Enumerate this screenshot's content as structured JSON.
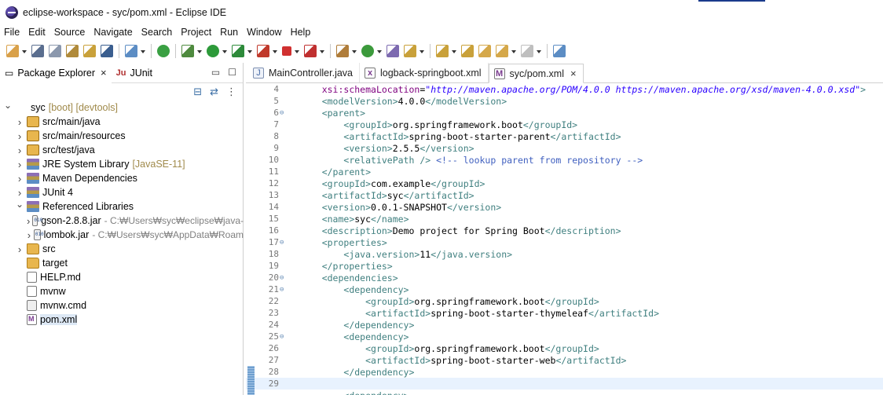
{
  "window": {
    "title": "eclipse-workspace - syc/pom.xml - Eclipse IDE"
  },
  "menu": [
    "File",
    "Edit",
    "Source",
    "Navigate",
    "Search",
    "Project",
    "Run",
    "Window",
    "Help"
  ],
  "left_panel": {
    "tabs": [
      {
        "label": "Package Explorer",
        "icon": "package-explorer-icon",
        "active": true
      },
      {
        "label": "JUnit",
        "icon": "junit-icon",
        "active": false
      }
    ],
    "tree": [
      {
        "label": "syc",
        "decoration": "[boot] [devtools]",
        "icon": "project",
        "level": 0,
        "expanded": true
      },
      {
        "label": "src/main/java",
        "icon": "pkgfolder",
        "level": 1,
        "expanded": false
      },
      {
        "label": "src/main/resources",
        "icon": "pkgfolder",
        "level": 1,
        "expanded": false
      },
      {
        "label": "src/test/java",
        "icon": "pkgfolder",
        "level": 1,
        "expanded": false
      },
      {
        "label": "JRE System Library",
        "decoration": "[JavaSE-11]",
        "icon": "lib",
        "level": 1,
        "expanded": false
      },
      {
        "label": "Maven Dependencies",
        "icon": "lib",
        "level": 1,
        "expanded": false
      },
      {
        "label": "JUnit 4",
        "icon": "lib",
        "level": 1,
        "expanded": false
      },
      {
        "label": "Referenced Libraries",
        "icon": "lib",
        "level": 1,
        "expanded": true
      },
      {
        "label": "gson-2.8.8.jar",
        "path": "- C:₩Users₩syc₩eclipse₩java-",
        "icon": "jar",
        "level": 2,
        "expanded": false
      },
      {
        "label": "lombok.jar",
        "path": "- C:₩Users₩syc₩AppData₩Roam",
        "icon": "jar",
        "level": 2,
        "expanded": false
      },
      {
        "label": "src",
        "icon": "folder",
        "level": 1,
        "expanded": false
      },
      {
        "label": "target",
        "icon": "folder",
        "level": 1,
        "expanded": null
      },
      {
        "label": "HELP.md",
        "icon": "file",
        "level": 1,
        "expanded": null
      },
      {
        "label": "mvnw",
        "icon": "file",
        "level": 1,
        "expanded": null
      },
      {
        "label": "mvnw.cmd",
        "icon": "gear",
        "level": 1,
        "expanded": null
      },
      {
        "label": "pom.xml",
        "icon": "xml",
        "level": 1,
        "expanded": null,
        "selected": true
      }
    ]
  },
  "editor": {
    "tabs": [
      {
        "label": "MainController.java",
        "active": false,
        "icon": "java-file-icon"
      },
      {
        "label": "logback-springboot.xml",
        "active": false,
        "icon": "xml-file-icon"
      },
      {
        "label": "syc/pom.xml",
        "active": true,
        "icon": "maven-pom-icon"
      }
    ],
    "lines": [
      {
        "n": "4",
        "fold": "",
        "text": "    xsi:schemaLocation=\"http://maven.apache.org/POM/4.0.0 https://maven.apache.org/xsd/maven-4.0.0.xsd\">"
      },
      {
        "n": "5",
        "fold": "",
        "text": "    <modelVersion>4.0.0</modelVersion>"
      },
      {
        "n": "6",
        "fold": "⊖",
        "text": "    <parent>"
      },
      {
        "n": "7",
        "fold": "",
        "text": "        <groupId>org.springframework.boot</groupId>"
      },
      {
        "n": "8",
        "fold": "",
        "text": "        <artifactId>spring-boot-starter-parent</artifactId>"
      },
      {
        "n": "9",
        "fold": "",
        "text": "        <version>2.5.5</version>"
      },
      {
        "n": "10",
        "fold": "",
        "text": "        <relativePath /> <!-- lookup parent from repository -->"
      },
      {
        "n": "11",
        "fold": "",
        "text": "    </parent>"
      },
      {
        "n": "12",
        "fold": "",
        "text": "    <groupId>com.example</groupId>"
      },
      {
        "n": "13",
        "fold": "",
        "text": "    <artifactId>syc</artifactId>"
      },
      {
        "n": "14",
        "fold": "",
        "text": "    <version>0.0.1-SNAPSHOT</version>"
      },
      {
        "n": "15",
        "fold": "",
        "text": "    <name>syc</name>"
      },
      {
        "n": "16",
        "fold": "",
        "text": "    <description>Demo project for Spring Boot</description>"
      },
      {
        "n": "17",
        "fold": "⊖",
        "text": "    <properties>"
      },
      {
        "n": "18",
        "fold": "",
        "text": "        <java.version>11</java.version>"
      },
      {
        "n": "19",
        "fold": "",
        "text": "    </properties>"
      },
      {
        "n": "20",
        "fold": "⊖",
        "text": "    <dependencies>"
      },
      {
        "n": "21",
        "fold": "⊖",
        "text": "        <dependency>"
      },
      {
        "n": "22",
        "fold": "",
        "text": "            <groupId>org.springframework.boot</groupId>"
      },
      {
        "n": "23",
        "fold": "",
        "text": "            <artifactId>spring-boot-starter-thymeleaf</artifactId>"
      },
      {
        "n": "24",
        "fold": "",
        "text": "        </dependency>"
      },
      {
        "n": "25",
        "fold": "⊖",
        "text": "        <dependency>"
      },
      {
        "n": "26",
        "fold": "",
        "text": "            <groupId>org.springframework.boot</groupId>"
      },
      {
        "n": "27",
        "fold": "",
        "text": "            <artifactId>spring-boot-starter-web</artifactId>"
      },
      {
        "n": "28",
        "fold": "",
        "text": "        </dependency>",
        "marked": true
      },
      {
        "n": "29",
        "fold": "",
        "text": "",
        "current": true,
        "marked": true
      },
      {
        "n": "",
        "fold": "",
        "text": "        <dependency>",
        "marked": true
      }
    ]
  },
  "toolbar_icons": [
    "new-icon",
    "save-icon",
    "save-all-icon",
    "properties-icon",
    "open-task-icon",
    "terminal-icon",
    "sep",
    "skip-breakpoints-icon",
    "sep",
    "spring-boot-icon",
    "sep",
    "debug-icon",
    "run-icon",
    "run-coverage-icon",
    "profile-icon",
    "stop-icon",
    "external-tools-icon",
    "sep",
    "new-project-icon",
    "refresh-icon",
    "open-type-icon",
    "search-icon",
    "sep",
    "next-annotation-icon",
    "prev-annotation-icon",
    "last-edit-icon",
    "back-icon",
    "forward-icon",
    "sep",
    "open-perspective-icon"
  ]
}
